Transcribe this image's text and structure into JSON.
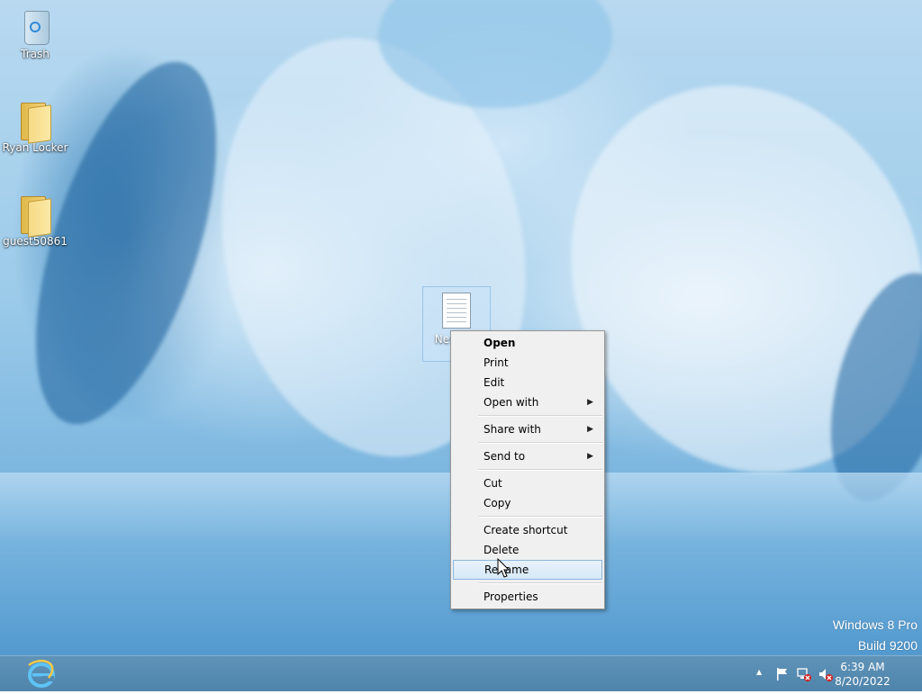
{
  "desktop": {
    "icons": [
      {
        "label": "Trash",
        "icon": "recycle-bin-icon"
      },
      {
        "label": "Ryan Locker",
        "icon": "folder-icon"
      },
      {
        "label": "guest50861",
        "icon": "folder-icon"
      }
    ],
    "selected_file": {
      "label": "Nev Doc",
      "icon": "text-document-icon"
    }
  },
  "context_menu": {
    "items": [
      {
        "label": "Open",
        "default": true
      },
      {
        "label": "Print"
      },
      {
        "label": "Edit"
      },
      {
        "label": "Open with",
        "submenu": true
      },
      {
        "label": "Share with",
        "submenu": true
      },
      {
        "label": "Send to",
        "submenu": true
      },
      {
        "label": "Cut"
      },
      {
        "label": "Copy"
      },
      {
        "label": "Create shortcut"
      },
      {
        "label": "Delete"
      },
      {
        "label": "Rename",
        "highlighted": true
      },
      {
        "label": "Properties"
      }
    ],
    "arrow_glyph": "▶"
  },
  "watermark": {
    "line1": "Windows 8 Pro",
    "line2": "Build 9200"
  },
  "taskbar": {
    "pinned": [
      {
        "icon": "internet-explorer-icon"
      }
    ],
    "tray": {
      "overflow_glyph": "▲",
      "icons": [
        "action-center-flag-icon",
        "network-disconnected-icon",
        "volume-muted-icon"
      ],
      "time": "6:39 AM",
      "date": "8/20/2022"
    }
  },
  "colors": {
    "taskbar": "#5a8db3",
    "menu_highlight": "#d6e8f8",
    "menu_highlight_border": "#8cb6df",
    "error_red": "#d02020"
  }
}
